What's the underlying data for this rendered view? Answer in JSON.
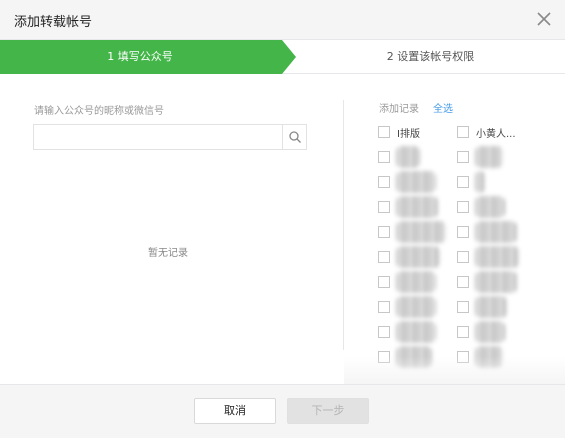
{
  "dialog": {
    "title": "添加转载帐号"
  },
  "steps": [
    {
      "label": "1 填写公众号",
      "active": true
    },
    {
      "label": "2 设置该帐号权限",
      "active": false
    }
  ],
  "search": {
    "label": "请输入公众号的昵称或微信号",
    "value": "",
    "placeholder": ""
  },
  "empty_text": "暂无记录",
  "records": {
    "title": "添加记录",
    "select_all": "全选",
    "left_column": [
      "I排版",
      "",
      "",
      "",
      "",
      "",
      "",
      "",
      "",
      ""
    ],
    "right_column": [
      "小黄人...",
      "",
      "",
      "",
      "",
      "",
      "",
      "",
      "",
      ""
    ]
  },
  "footer": {
    "cancel": "取消",
    "next": "下一步"
  },
  "colors": {
    "accent_green": "#44b549",
    "link_blue": "#459ae9",
    "header_bg": "#f5f5f5"
  }
}
